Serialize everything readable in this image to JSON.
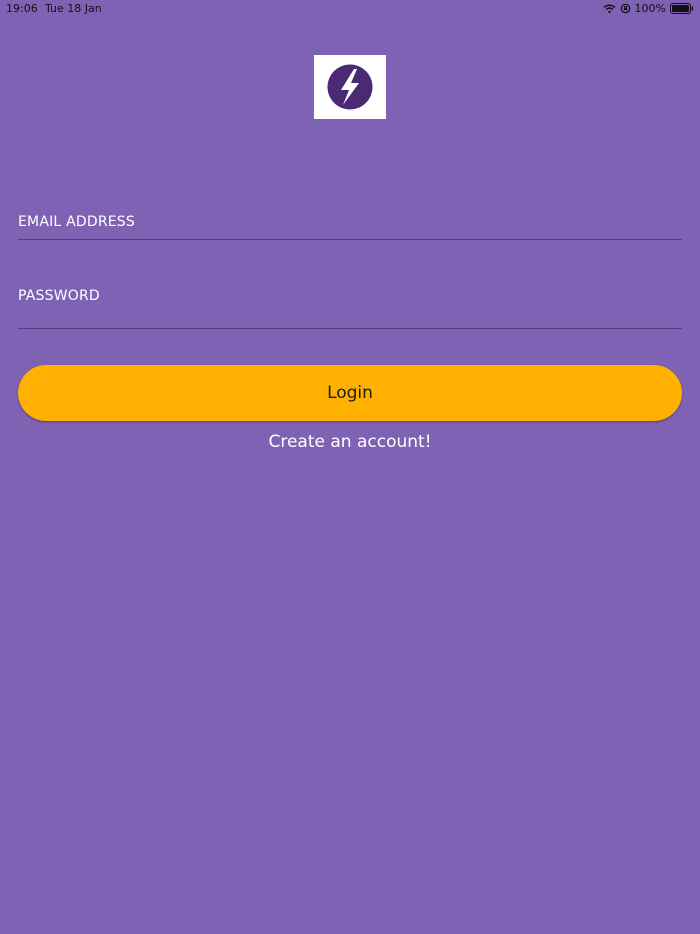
{
  "status_bar": {
    "time": "19:06",
    "date": "Tue 18 Jan",
    "battery_percent": "100%",
    "icons": [
      "wifi-icon",
      "orientation-lock-icon",
      "battery-icon"
    ]
  },
  "logo": {
    "icon": "lightning-bolt-icon",
    "colors": {
      "background": "#ffffff",
      "circle": "#4a2a72",
      "bolt": "#ffffff"
    }
  },
  "form": {
    "email_placeholder": "EMAIL ADDRESS",
    "email_value": "",
    "password_placeholder": "PASSWORD",
    "password_value": "",
    "login_label": "Login",
    "create_account_label": "Create an account!"
  },
  "theme": {
    "background": "#7f62b4",
    "accent": "#ffb000",
    "underline": "#4f3d82"
  }
}
